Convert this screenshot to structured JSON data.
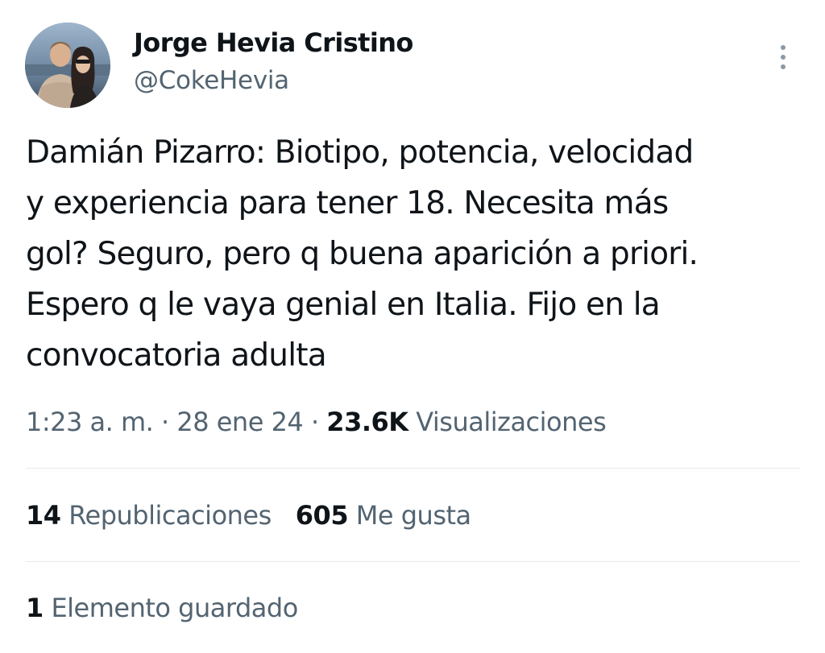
{
  "author": {
    "display_name": "Jorge Hevia Cristino",
    "handle": "@CokeHevia"
  },
  "tweet": {
    "text": "Damián Pizarro: Biotipo, potencia, velocidad\ny experiencia para tener 18. Necesita más\ngol? Seguro, pero q buena aparición a priori.\nEspero q le vaya genial en Italia. Fijo en la\nconvocatoria adulta"
  },
  "meta": {
    "time": "1:23 a. m.",
    "separator": "·",
    "date": "28 ene 24",
    "views_count": "23.6K",
    "views_label": "Visualizaciones"
  },
  "stats": {
    "reposts_count": "14",
    "reposts_label": "Republicaciones",
    "likes_count": "605",
    "likes_label": "Me gusta",
    "bookmarks_count": "1",
    "bookmarks_label": "Elemento guardado"
  },
  "icons": {
    "more": "more-vertical-icon"
  },
  "colors": {
    "text_primary": "#0f1419",
    "text_secondary": "#536471",
    "divider": "#e6e9eb"
  }
}
